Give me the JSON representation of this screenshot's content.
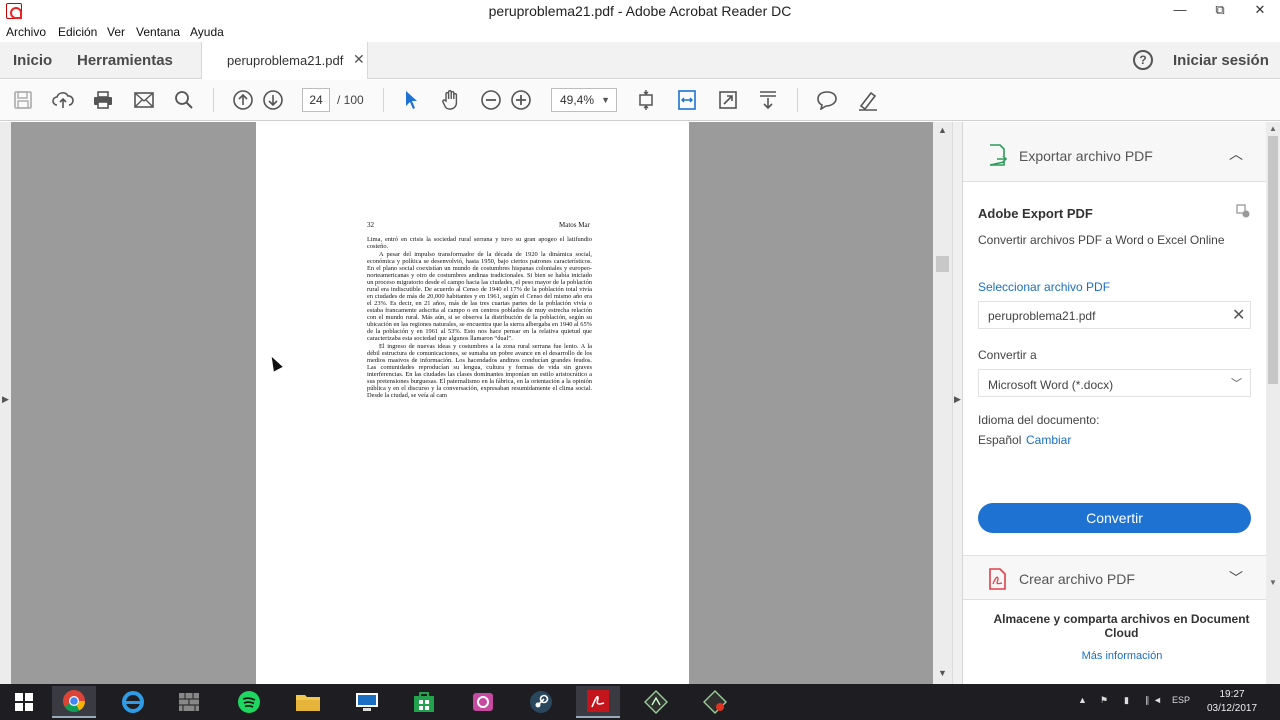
{
  "window": {
    "title": "peruproblema21.pdf - Adobe Acrobat Reader DC",
    "minimize": "—",
    "maximize": "⧉",
    "close": "✕"
  },
  "menu": [
    "Archivo",
    "Edición",
    "Ver",
    "Ventana",
    "Ayuda"
  ],
  "tabs": {
    "home": "Inicio",
    "tools": "Herramientas",
    "document": "peruproblema21.pdf",
    "close": "✕",
    "help": "?",
    "signin": "Iniciar sesión"
  },
  "toolbar": {
    "page_current": "24",
    "page_total": "/ 100",
    "zoom": "49,4%",
    "zoom_arrow": "▼"
  },
  "document": {
    "header_left": "32",
    "header_right": "Matos Mar",
    "paragraphs": [
      {
        "indent": false,
        "text": "Lima, entró en crisis la sociedad rural serrana y tuvo su gran apogeo el latifundio costeño."
      },
      {
        "indent": true,
        "text": "A pesar del impulso transformador de la década de 1920 la dinámica social, económica y política se desenvolvió, hasta 1950, bajo ciertos patrones característicos. En el plano social coexistían un mundo de costumbres hispanas coloniales y europeo-norteamericanas y otro de costumbres andinas tradicionales. Si bien se había iniciado un proceso migratorio desde el campo hacia las ciudades, el peso mayor de la población rural era indiscutible. De acuerdo al Censo de 1940 el 17% de la población total vivía en ciudades de más de 20,000 habitantes y en 1961, según el Censo del mismo año era el 23%. Es decir, en 21 años, más de las tres cuartas partes de la población vivía o estaba francamente adscrita al campo o en centros poblados de muy estrecha relación con el mundo rural. Más aún, si se observa la distribución de la población, según su ubicación en las regiones naturales, se encuentra que la sierra albergaba en 1940 al 65% de la población y en 1961 al 53%. Esto nos hace pensar en la relativa quietud que caracterizaba esta sociedad que algunos llamaron “dual”."
      },
      {
        "indent": true,
        "text": "El ingreso de nuevas ideas y costumbres a la zona rural serrana fue lento. A la débil estructura de comunicaciones, se sumaba un pobre avance en el desarrollo de los medios masivos de información. Los hacendados andinos conducían grandes feudos. Las comunidades reproducían su lengua, cultura y formas de vida sin graves interferencias. En las ciudades las clases dominantes imponían un estilo aristocrático a sus pretensiones burguesas. El paternalismo en la fábrica, en la orientación a la opinión pública y en el discurso y la conversación, expresaban resumidamente el clima social. Desde la ciudad, se veía al cam"
      }
    ]
  },
  "panel": {
    "export_title": "Exportar archivo PDF",
    "adobe_export_title": "Adobe Export PDF",
    "adobe_export_sub": "Convertir archivos PDF a Word o Excel Online",
    "select_file_label": "Seleccionar archivo PDF",
    "selected_file": "peruproblema21.pdf",
    "convert_to_label": "Convertir a",
    "format": "Microsoft Word (*.docx)",
    "language_label": "Idioma del documento:",
    "language_value": "Español",
    "language_change": "Cambiar",
    "convert_button": "Convertir",
    "create_title": "Crear archivo PDF",
    "cloud_text": "Almacene y comparta archivos en Document Cloud",
    "more_info": "Más información"
  },
  "taskbar": {
    "lang": "ESP",
    "time": "19:27",
    "date": "03/12/2017"
  },
  "colors": {
    "accent": "#1e73d2",
    "link": "#1a6fc4",
    "doc_bg": "#9b9b9b",
    "taskbar": "#1d1d22"
  }
}
